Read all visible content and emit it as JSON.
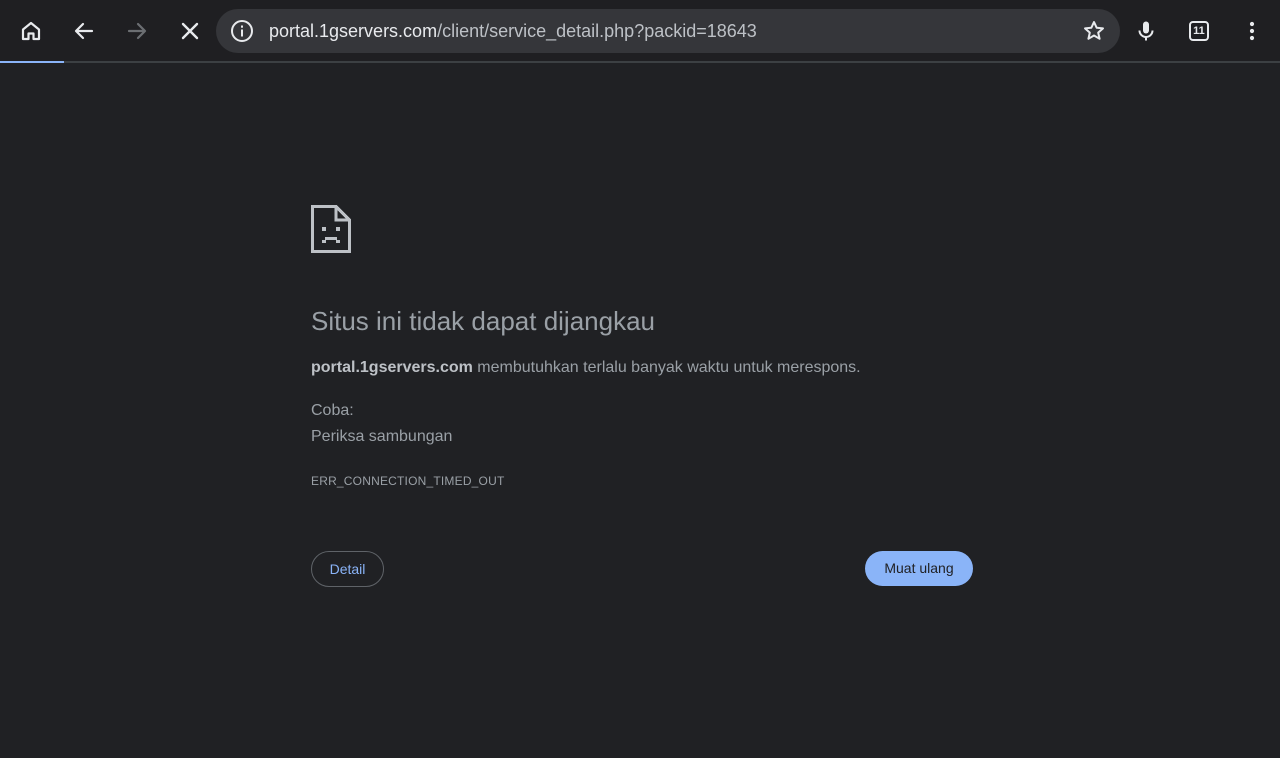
{
  "browser": {
    "url_host": "portal.1gservers.com",
    "url_path": "/client/service_detail.php?packid=18643",
    "tab_count": "11",
    "load_progress_percent": 5,
    "icons": {
      "home": "home-icon",
      "back": "back-arrow-icon",
      "forward": "forward-arrow-icon",
      "stop": "close-icon",
      "site_info": "info-icon",
      "bookmark": "star-outline-icon",
      "voice": "microphone-icon",
      "tabs": "tab-switcher-icon",
      "menu": "more-vert-icon"
    }
  },
  "error_page": {
    "icon": "sad-document-icon",
    "title": "Situs ini tidak dapat dijangkau",
    "summary_host": "portal.1gservers.com",
    "summary_text": " membutuhkan terlalu banyak waktu untuk merespons.",
    "try_label": "Coba:",
    "suggestion": "Periksa sambungan",
    "error_code": "ERR_CONNECTION_TIMED_OUT",
    "details_button": "Detail",
    "reload_button": "Muat ulang"
  },
  "colors": {
    "background": "#202124",
    "toolbar": "#1f1f22",
    "omnibox": "#35363a",
    "accent": "#8ab4f8",
    "text_secondary": "#9aa0a6"
  }
}
